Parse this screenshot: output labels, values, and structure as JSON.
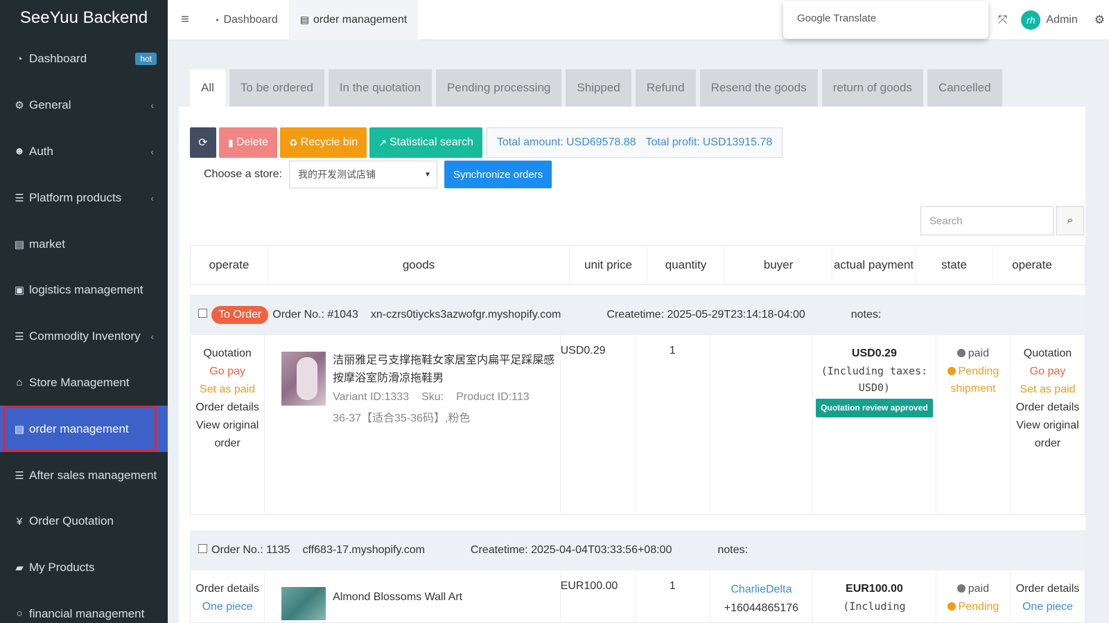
{
  "sidebar": {
    "brand": "SeeYuu Backend",
    "items": [
      {
        "label": "Dashboard",
        "icon": "dashboard-icon",
        "badge": "hot"
      },
      {
        "label": "General",
        "icon": "gears-icon"
      },
      {
        "label": "Auth",
        "icon": "users-icon"
      },
      {
        "label": "Platform products",
        "icon": "list-icon"
      },
      {
        "label": "market",
        "icon": "file-icon"
      },
      {
        "label": "logistics management",
        "icon": "truck-icon"
      },
      {
        "label": "Commodity Inventory",
        "icon": "list-icon"
      },
      {
        "label": "Store Management",
        "icon": "bank-icon"
      },
      {
        "label": "order management",
        "icon": "file-icon"
      },
      {
        "label": "After sales management",
        "icon": "list-icon"
      },
      {
        "label": "Order Quotation",
        "icon": "yen-icon",
        "glyph": "¥"
      },
      {
        "label": "My Products",
        "icon": "shopping-bag-icon"
      },
      {
        "label": "financial management",
        "icon": "circle-icon"
      }
    ]
  },
  "topbar": {
    "tabs": [
      {
        "label": "Dashboard"
      },
      {
        "label": "order management"
      }
    ],
    "translate": "Google Translate",
    "user": "Admin"
  },
  "status_tabs": [
    "All",
    "To be ordered",
    "In the quotation",
    "Pending processing",
    "Shipped",
    "Refund",
    "Resend the goods",
    "return of goods",
    "Cancelled"
  ],
  "toolbar": {
    "delete": "Delete",
    "recycle": "Recycle bin",
    "stat": "Statistical search",
    "total_amount_label": "Total amount:",
    "total_amount": "USD69578.88",
    "total_profit_label": "Total profit:",
    "total_profit": "USD13915.78",
    "store_label": "Choose a store:",
    "store_value": "我的开发测试店铺",
    "sync": "Synchronize orders",
    "search_placeholder": "Search"
  },
  "table": {
    "headers": [
      "operate",
      "goods",
      "unit price",
      "quantity",
      "buyer",
      "actual payment",
      "state",
      "operate"
    ]
  },
  "orders": [
    {
      "badge": "To Order",
      "order_no": "Order No.: #1043",
      "store": "xn-czrs0tiycks3azwofgr.myshopify.com",
      "createtime": "Createtime: 2025-05-29T23:14:18-04:00",
      "notes": "notes:",
      "ops": [
        "Quotation",
        "Go pay",
        "Set as paid",
        "Order details",
        "View original order"
      ],
      "goods_name": "洁丽雅足弓支撑拖鞋女家居室内扁平足踩屎感按摩浴室防滑凉拖鞋男",
      "variant": "Variant ID:1333",
      "sku": "Sku:",
      "product": "Product ID:113",
      "spec": "36-37【适合35-36码】,粉色",
      "unit_price": "USD0.29",
      "quantity": "1",
      "buyer": "",
      "payment": "USD0.29",
      "payment_note": "(Including taxes: USD0)",
      "approved": "Quotation review approved",
      "state_paid": "paid",
      "state_pending": "Pending shipment",
      "ops2": [
        "Quotation",
        "Go pay",
        "Set as paid",
        "Order details",
        "View original order"
      ]
    },
    {
      "order_no": "Order No.: 1135",
      "store": "cff683-17.myshopify.com",
      "createtime": "Createtime: 2025-04-04T03:33:56+08:00",
      "notes": "notes:",
      "ops": [
        "Order details",
        "One piece"
      ],
      "goods_name": "Almond Blossoms Wall Art",
      "unit_price": "EUR100.00",
      "quantity": "1",
      "buyer_name": "CharlieDelta",
      "buyer_phone": "+16044865176",
      "payment": "EUR100.00",
      "payment_note": "(Including",
      "state_paid": "paid",
      "state_pending": "Pending",
      "ops2": [
        "Order details",
        "One piece"
      ]
    }
  ]
}
